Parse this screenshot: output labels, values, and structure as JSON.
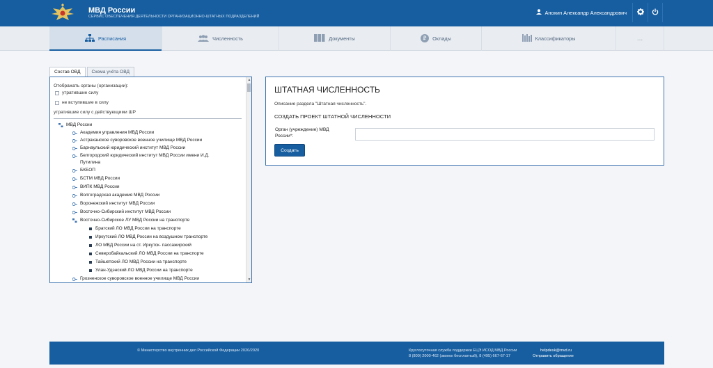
{
  "header": {
    "title": "МВД России",
    "subtitle": "СЕРВИС ОБЕСПЕЧЕНИЯ ДЕЯТЕЛЬНОСТИ ОРГАНИЗАЦИОННО-ШТАТНЫХ ПОДРАЗДЕЛЕНИЙ",
    "user_name": "Анохин Александр Александрович"
  },
  "nav": {
    "items": [
      {
        "label": "Расписания",
        "icon": "org-chart-icon"
      },
      {
        "label": "Численность",
        "icon": "people-icon"
      },
      {
        "label": "Документы",
        "icon": "documents-icon"
      },
      {
        "label": "Оклады",
        "icon": "ruble-coin-icon"
      },
      {
        "label": "Классификаторы",
        "icon": "classifiers-icon"
      },
      {
        "label": "..."
      }
    ]
  },
  "left_panel": {
    "tabs": [
      "Состав ОВД",
      "Схема учёта ОВД"
    ],
    "filter_title": "Отображать органы (организации):",
    "checkboxes": [
      "утратившие силу",
      "не вступившие в силу"
    ],
    "filter_note": "утратившие силу с действующими ШР",
    "tree": [
      "МВД России",
      "Академия управления МВД России",
      "Астраханское суворовское военное училище МВД России",
      "Барнаульский юридический институт МВД России",
      "Белгородский юридический институт МВД России имени И.Д. Путилина",
      "БКБОП",
      "БСТМ МВД России",
      "ВИПК МВД России",
      "Волгоградская академия МВД России",
      "Воронежский институт МВД России",
      "Восточно-Сибирский институт МВД России",
      "Восточно-Сибирское ЛУ МВД России на транспорте",
      "Братский ЛО МВД России на транспорте",
      "Иркутский ЛО МВД России на воздушном транспорте",
      "ЛО МВД России на ст. Иркутск- пассажирский",
      "Северобайкальский ЛО МВД России на транспорте",
      "Тайшетский ЛО МВД России на транспорте",
      "Улан-Удэнский ЛО МВД России на транспорте",
      "Грозненское суворовское военное училище МВД России"
    ]
  },
  "main": {
    "title": "ШТАТНАЯ ЧИСЛЕННОСТЬ",
    "description": "Описание раздела \"Штатная численность\".",
    "subtitle": "СОЗДАТЬ ПРОЕКТ ШТАТНОЙ ЧИСЛЕННОСТИ",
    "field_label": "Орган (учреждение) МВД России*:",
    "field_value": "",
    "create_button": "Создать"
  },
  "footer": {
    "copyright": "© Министерство внутренних дел Российской Федерации 2020/2020",
    "support_line1": "Круглосуточная служба поддержки ЕЦЭ ИСОД МВД России",
    "support_line2": "8 (800) 2000-462 (звонок бесплатный), 8 (495) 667-67-17",
    "email": "helpdesk@mvd.ru",
    "send_request": "Отправить обращение"
  },
  "colors": {
    "primary": "#175ea0",
    "nav_bg": "#e9edf2",
    "page_bg": "#f3f5f8",
    "panel_border": "#3f75b0"
  }
}
